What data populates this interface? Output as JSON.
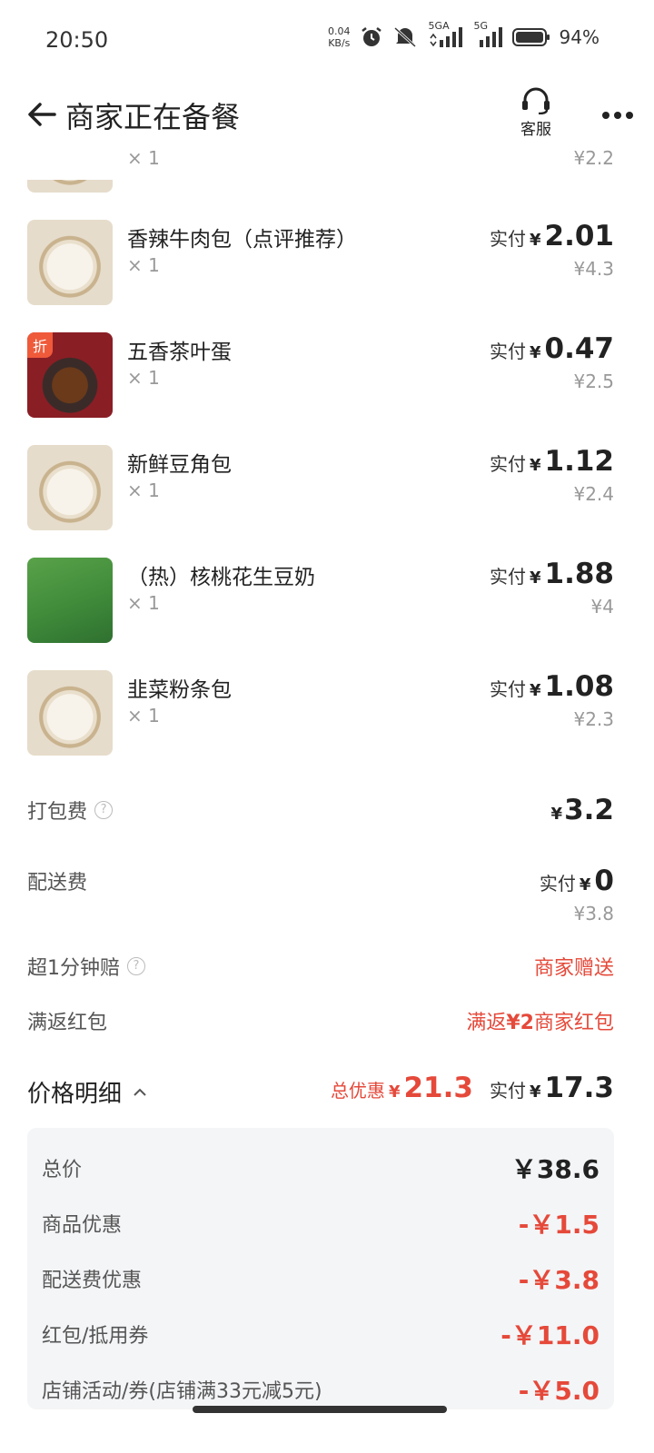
{
  "status_bar": {
    "time": "20:50",
    "net_speed_value": "0.04",
    "net_speed_unit": "KB/s",
    "sim1_label": "5GA",
    "sim2_label": "5G",
    "battery": "94%"
  },
  "header": {
    "title": "商家正在备餐",
    "service_label": "客服",
    "icons": [
      "back-arrow-icon",
      "headset-icon",
      "more-dots-icon"
    ]
  },
  "items": [
    {
      "name": "",
      "qty": "× 1",
      "pay_label": "",
      "pay_amount": "",
      "original": "¥2.2",
      "thumb": "bun"
    },
    {
      "name": "香辣牛肉包（点评推荐）",
      "qty": "× 1",
      "pay_label": "实付",
      "pay_amount": "2.01",
      "original": "¥4.3",
      "thumb": "bun"
    },
    {
      "name": "五香茶叶蛋",
      "qty": "× 1",
      "pay_label": "实付",
      "pay_amount": "0.47",
      "original": "¥2.5",
      "thumb": "egg",
      "tag": "折"
    },
    {
      "name": "新鲜豆角包",
      "qty": "× 1",
      "pay_label": "实付",
      "pay_amount": "1.12",
      "original": "¥2.4",
      "thumb": "bun"
    },
    {
      "name": "（热）核桃花生豆奶",
      "qty": "× 1",
      "pay_label": "实付",
      "pay_amount": "1.88",
      "original": "¥4",
      "thumb": "drink"
    },
    {
      "name": "韭菜粉条包",
      "qty": "× 1",
      "pay_label": "实付",
      "pay_amount": "1.08",
      "original": "¥2.3",
      "thumb": "bun"
    }
  ],
  "fees": {
    "packing_label": "打包费",
    "packing_value": "3.2",
    "delivery_label": "配送费",
    "delivery_pay_label": "实付",
    "delivery_value": "0",
    "delivery_original": "¥3.8",
    "late_label": "超1分钟赔",
    "late_value": "商家赠送",
    "redpack_label": "满返红包",
    "redpack_prefix": "满返",
    "redpack_amount": "¥2",
    "redpack_suffix": "商家红包"
  },
  "summary": {
    "title": "价格明细",
    "discount_label": "总优惠",
    "discount_value": "21.3",
    "pay_label": "实付",
    "pay_value": "17.3"
  },
  "price_details": [
    {
      "label": "总价",
      "value": "￥38.6",
      "negative": false
    },
    {
      "label": "商品优惠",
      "value": "-￥1.5",
      "negative": true
    },
    {
      "label": "配送费优惠",
      "value": "-￥3.8",
      "negative": true
    },
    {
      "label": "红包/抵用券",
      "value": "-￥11.0",
      "negative": true
    },
    {
      "label": "店铺活动/券(店铺满33元减5元)",
      "value": "-￥5.0",
      "negative": true
    }
  ],
  "yen": "¥",
  "colors": {
    "accent_red": "#e5493a",
    "text": "#222222",
    "muted": "#999999",
    "panel_bg": "#f4f5f7"
  }
}
